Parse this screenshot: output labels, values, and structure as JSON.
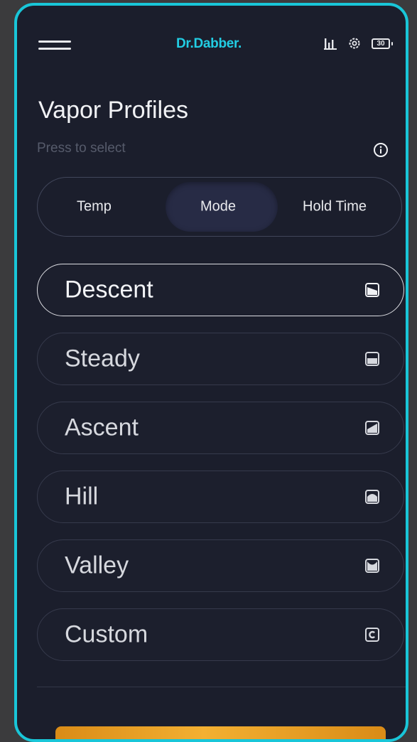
{
  "header": {
    "brand": "Dr.Dabber.",
    "battery_level": "30",
    "icons": [
      "menu-icon",
      "bar-chart-icon",
      "settings-gear-icon",
      "battery-icon"
    ]
  },
  "page": {
    "title": "Vapor Profiles",
    "subtitle": "Press to select",
    "info_icon": "info-icon"
  },
  "segmented": {
    "options": [
      "Temp",
      "Mode",
      "Hold Time"
    ],
    "selected": "Mode"
  },
  "profiles": [
    {
      "label": "Descent",
      "icon": "descent-icon",
      "selected": true
    },
    {
      "label": "Steady",
      "icon": "steady-icon",
      "selected": false
    },
    {
      "label": "Ascent",
      "icon": "ascent-icon",
      "selected": false
    },
    {
      "label": "Hill",
      "icon": "hill-icon",
      "selected": false
    },
    {
      "label": "Valley",
      "icon": "valley-icon",
      "selected": false
    },
    {
      "label": "Custom",
      "icon": "custom-icon",
      "selected": false
    }
  ],
  "colors": {
    "accent": "#19c6d8",
    "background": "#1b1e2c",
    "cta": "#f3b032"
  }
}
